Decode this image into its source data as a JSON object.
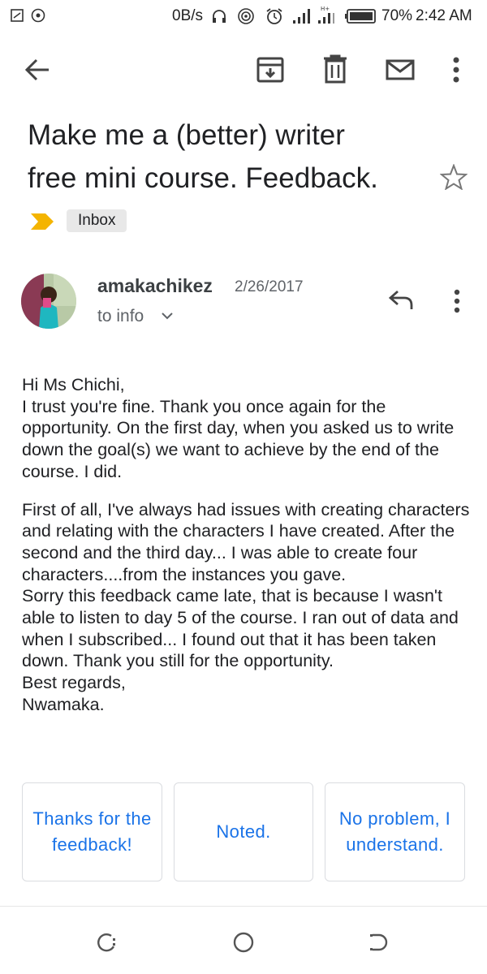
{
  "status_bar": {
    "network_speed": "0B/s",
    "battery": "70%",
    "time": "2:42 AM"
  },
  "toolbar": {
    "icons": [
      "back-arrow-icon",
      "archive-icon",
      "delete-icon",
      "mark-unread-icon",
      "more-vert-icon"
    ]
  },
  "subject": {
    "line1": "Make me a (better) writer",
    "line2": "free mini course. Feedback.",
    "label": "Inbox",
    "importance_color": "#f4b400"
  },
  "message": {
    "sender": "amakachikez",
    "date": "2/26/2017",
    "recipient": "to info",
    "body": [
      "Hi Ms Chichi,\nI trust you're fine.  Thank you once again for the opportunity.  On the first day, when you asked us to write down the goal(s)  we want to achieve by the end of the course.  I did.",
      "First of all,  I've always had issues with creating characters and relating with the characters I have created.  After the second and the third day...  I was able to create four characters....from the instances you gave.\nSorry this feedback came late,  that is because I wasn't able to listen to day 5 of the course.  I ran out of data and when I subscribed... I found out that it has been taken down.  Thank you still for the opportunity.\nBest regards,\nNwamaka."
    ]
  },
  "smart_replies": [
    "Thanks for the feedback!",
    "Noted.",
    "No problem, I understand."
  ],
  "colors": {
    "accent": "#1a73e8",
    "chip_bg": "#e8e8e8"
  }
}
